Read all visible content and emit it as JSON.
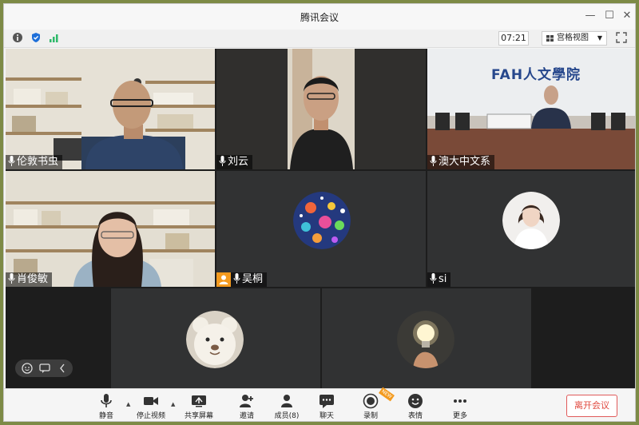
{
  "window": {
    "title": "腾讯会议"
  },
  "toolbar": {
    "timer": "07:21",
    "view_mode": "宫格视图"
  },
  "participants": [
    {
      "name": "伦敦书虫"
    },
    {
      "name": "刘云"
    },
    {
      "name": "澳大中文系"
    },
    {
      "name": "肖俊敏"
    },
    {
      "name": "吴桐"
    },
    {
      "name": "si"
    }
  ],
  "room_logo": {
    "text": "FAH人文學院"
  },
  "bottombar": {
    "mute": "静音",
    "stop_video": "停止视频",
    "share_screen": "共享屏幕",
    "invite": "邀请",
    "members": "成员(8)",
    "chat": "聊天",
    "record": "录制",
    "reactions": "表情",
    "more": "更多",
    "leave": "离开会议",
    "new_badge": "NEW"
  },
  "colors": {
    "active_speaker": "#2fb96a",
    "leave": "#e0493f",
    "new_badge": "#f39a1e"
  }
}
